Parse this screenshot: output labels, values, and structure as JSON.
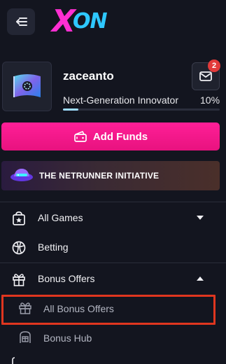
{
  "header": {
    "collapse_icon": "collapse-sidebar-icon",
    "logo_x": "X",
    "logo_on": "ON"
  },
  "profile": {
    "username": "zaceanto",
    "level_name": "Next-Generation Innovator",
    "level_percent_text": "10%",
    "level_progress": 0.1,
    "notifications_count": "2"
  },
  "actions": {
    "add_funds_label": "Add Funds"
  },
  "banner": {
    "initiative_label": "THE NETRUNNER INITIATIVE"
  },
  "nav": {
    "items": [
      {
        "label": "All Games",
        "icon": "star-box-icon",
        "caret": "down"
      },
      {
        "label": "Betting",
        "icon": "ball-icon"
      },
      {
        "label": "Bonus Offers",
        "icon": "gift-icon",
        "caret": "up"
      }
    ],
    "sub_items": [
      {
        "label": "All Bonus Offers",
        "icon": "gift-icon"
      },
      {
        "label": "Bonus Hub",
        "icon": "bonus-hub-icon"
      }
    ]
  },
  "colors": {
    "background": "#13151f",
    "accent_pink": "#ff1f97",
    "logo_pink": "#ff2fd2",
    "logo_blue": "#2ec8ff",
    "highlight": "#e0361f",
    "badge": "#e23a3a"
  }
}
